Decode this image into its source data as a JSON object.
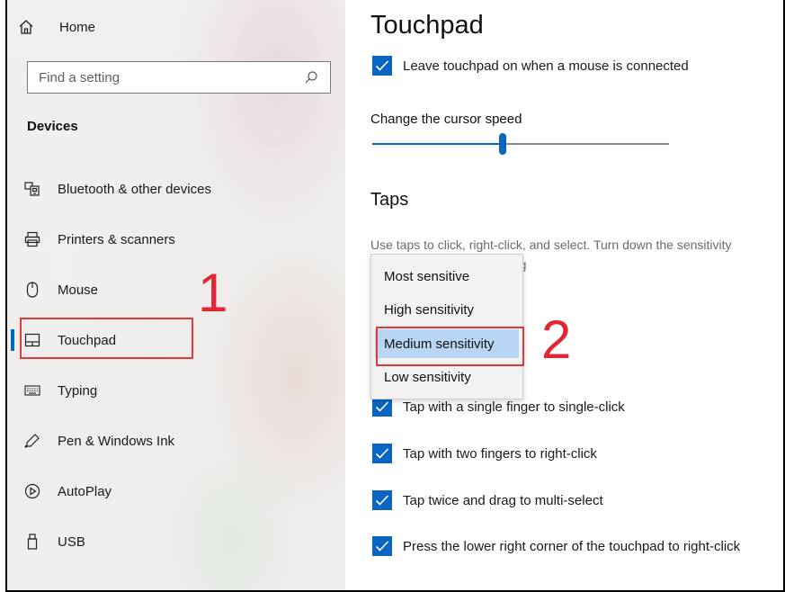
{
  "sidebar": {
    "home_label": "Home",
    "search_placeholder": "Find a setting",
    "section_title": "Devices",
    "items": [
      {
        "label": "Bluetooth & other devices",
        "icon": "bluetooth-devices-icon"
      },
      {
        "label": "Printers & scanners",
        "icon": "printer-icon"
      },
      {
        "label": "Mouse",
        "icon": "mouse-icon"
      },
      {
        "label": "Touchpad",
        "icon": "touchpad-icon",
        "active": true
      },
      {
        "label": "Typing",
        "icon": "keyboard-icon"
      },
      {
        "label": "Pen & Windows Ink",
        "icon": "pen-icon"
      },
      {
        "label": "AutoPlay",
        "icon": "autoplay-icon"
      },
      {
        "label": "USB",
        "icon": "usb-icon"
      }
    ]
  },
  "annotations": {
    "step1": "1",
    "step2": "2",
    "highlight_color": "#e32636"
  },
  "main": {
    "title": "Touchpad",
    "leave_on_label": "Leave touchpad on when a mouse is connected",
    "cursor_speed_label": "Change the cursor speed",
    "cursor_speed_fraction": 0.44,
    "taps_heading": "Taps",
    "taps_description_line1": "Use taps to click, right-click, and select. Turn down the sensitivity",
    "taps_description_line2_fragment": "yping",
    "sensitivity_options": [
      "Most sensitive",
      "High sensitivity",
      "Medium sensitivity",
      "Low sensitivity"
    ],
    "selected_sensitivity": "Medium sensitivity",
    "tap_options": [
      {
        "label": "Tap with a single finger to single-click",
        "checked": true
      },
      {
        "label": "Tap with two fingers to right-click",
        "checked": true
      },
      {
        "label": "Tap twice and drag to multi-select",
        "checked": true
      },
      {
        "label": "Press the lower right corner of the touchpad to right-click",
        "checked": true
      }
    ]
  },
  "colors": {
    "accent": "#0067c0",
    "checkbox": "#0a66c2",
    "selected_option": "#b8d6f3"
  }
}
